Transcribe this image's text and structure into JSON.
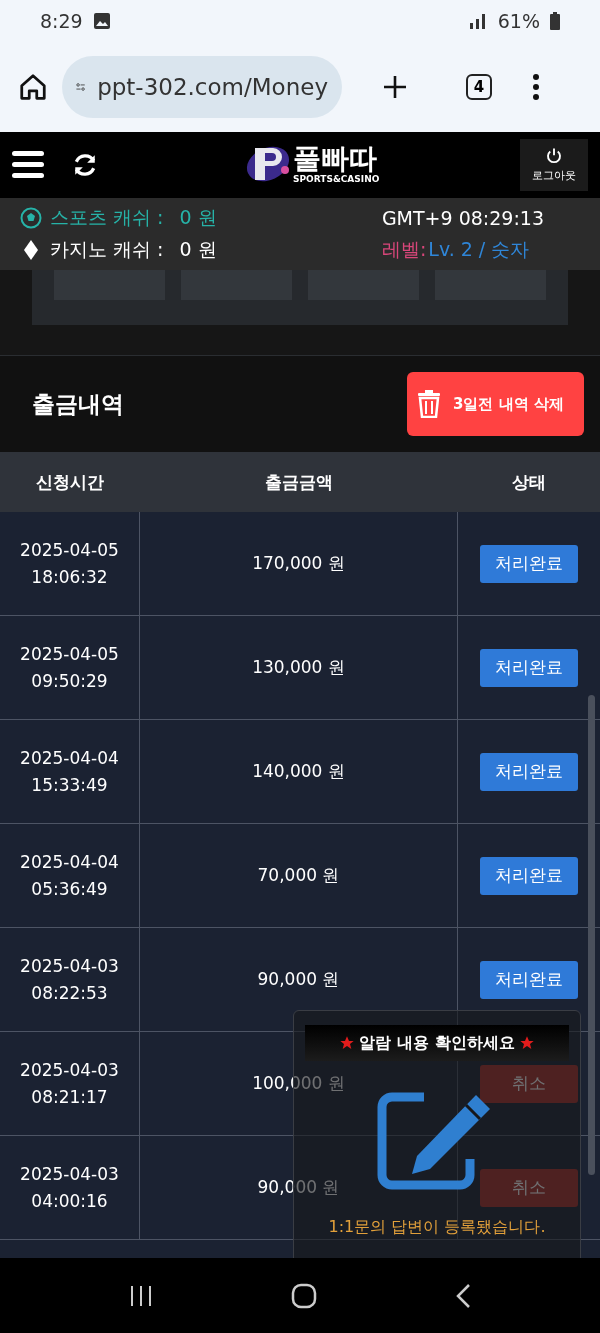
{
  "status_bar": {
    "time": "8:29",
    "battery": "61%"
  },
  "browser": {
    "url": "ppt-302.com/Money",
    "tab_count": "4"
  },
  "header": {
    "logo_text": "풀빠따",
    "logo_sub": "SPORTS&CASINO",
    "logout": "로그아웃"
  },
  "info": {
    "sports_label": "스포츠 캐쉬 :",
    "sports_value": "0 원",
    "casino_label": "카지노 캐쉬 :",
    "casino_value": "0 원",
    "clock": "GMT+9 08:29:13",
    "level_label": "레벨:",
    "level_value": "Lv. 2 / 숫자"
  },
  "section": {
    "title": "출금내역",
    "delete_button": "3일전 내역 삭제"
  },
  "table": {
    "columns": [
      "신청시간",
      "출금금액",
      "상태"
    ],
    "rows": [
      {
        "date": "2025-04-05",
        "time": "18:06:32",
        "amount": "170,000 원",
        "status": "처리완료",
        "kind": "done"
      },
      {
        "date": "2025-04-05",
        "time": "09:50:29",
        "amount": "130,000 원",
        "status": "처리완료",
        "kind": "done"
      },
      {
        "date": "2025-04-04",
        "time": "15:33:49",
        "amount": "140,000 원",
        "status": "처리완료",
        "kind": "done"
      },
      {
        "date": "2025-04-04",
        "time": "05:36:49",
        "amount": "70,000 원",
        "status": "처리완료",
        "kind": "done"
      },
      {
        "date": "2025-04-03",
        "time": "08:22:53",
        "amount": "90,000 원",
        "status": "처리완료",
        "kind": "done"
      },
      {
        "date": "2025-04-03",
        "time": "08:21:17",
        "amount": "100,000 원",
        "status": "취소",
        "kind": "cancel"
      },
      {
        "date": "2025-04-03",
        "time": "04:00:16",
        "amount": "90,000 원",
        "status": "취소",
        "kind": "cancel"
      }
    ]
  },
  "popup": {
    "title": "알람 내용 확인하세요",
    "message": "1:1문의 답변이 등록됐습니다."
  }
}
